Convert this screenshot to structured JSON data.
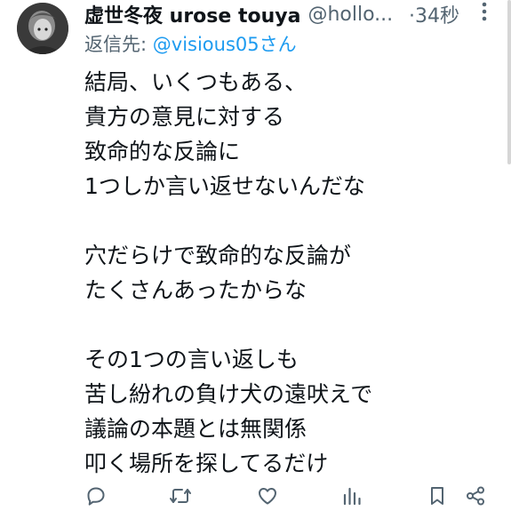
{
  "post": {
    "display_name": "虚世冬夜 urose touya",
    "handle": "@hollo...",
    "time": "·34秒",
    "replying_to_label": "返信先: ",
    "replying_to_user": "@visious05さん",
    "lines": [
      "結局、いくつもある、",
      "貴方の意見に対する",
      "致命的な反論に",
      "1つしか言い返せないんだな",
      "",
      "穴だらけで致命的な反論が",
      "たくさんあったからな",
      "",
      "その1つの言い返しも",
      "苦し紛れの負け犬の遠吠えで",
      "議論の本題とは無関係",
      "叩く場所を探してるだけ"
    ]
  },
  "actions": {
    "icons": [
      "reply-icon",
      "repost-icon",
      "like-icon",
      "views-icon",
      "bookmark-icon",
      "share-icon"
    ]
  },
  "colors": {
    "text": "#0f1419",
    "muted": "#536471",
    "accent": "#1d9bf0"
  }
}
